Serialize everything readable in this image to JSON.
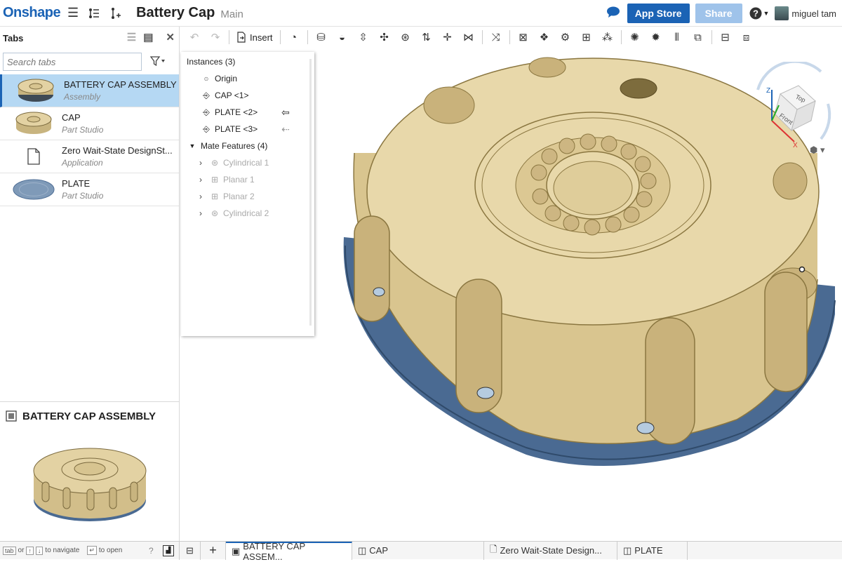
{
  "topbar": {
    "logo": "Onshape",
    "doc_title": "Battery Cap",
    "branch": "Main",
    "app_store_label": "App Store",
    "share_label": "Share",
    "user_name": "miguel tam"
  },
  "tabs_panel": {
    "title": "Tabs",
    "search_placeholder": "Search tabs",
    "items": [
      {
        "name": "BATTERY CAP ASSEMBLY",
        "type": "Assembly"
      },
      {
        "name": "CAP",
        "type": "Part Studio"
      },
      {
        "name": "Zero Wait-State DesignSt...",
        "type": "Application"
      },
      {
        "name": "PLATE",
        "type": "Part Studio"
      }
    ],
    "preview_title": "BATTERY CAP ASSEMBLY"
  },
  "toolbar": {
    "insert_label": "Insert"
  },
  "instance_list": {
    "instances_header": "Instances (3)",
    "origin": "Origin",
    "instances": [
      "CAP <1>",
      "PLATE <2>",
      "PLATE <3>"
    ],
    "mate_header": "Mate Features (4)",
    "mates": [
      "Cylindrical 1",
      "Planar 1",
      "Planar 2",
      "Cylindrical 2"
    ]
  },
  "viewcube": {
    "top": "Top",
    "front": "Front",
    "z": "Z",
    "x": "X"
  },
  "bottom_bar": {
    "hint_tab": "tab",
    "hint_or": "or",
    "hint_up": "↑",
    "hint_down": "↓",
    "hint_navigate": "to navigate",
    "hint_enter": "↵",
    "hint_open": "to open",
    "tabs": [
      "BATTERY CAP ASSEM...",
      "CAP",
      "Zero Wait-State Design...",
      "PLATE"
    ]
  },
  "colors": {
    "brand_blue": "#1b63b5",
    "cap_tan": "#e3d2a3",
    "plate_blue": "#4a6a92",
    "selected_tab": "#b5d8f3"
  }
}
